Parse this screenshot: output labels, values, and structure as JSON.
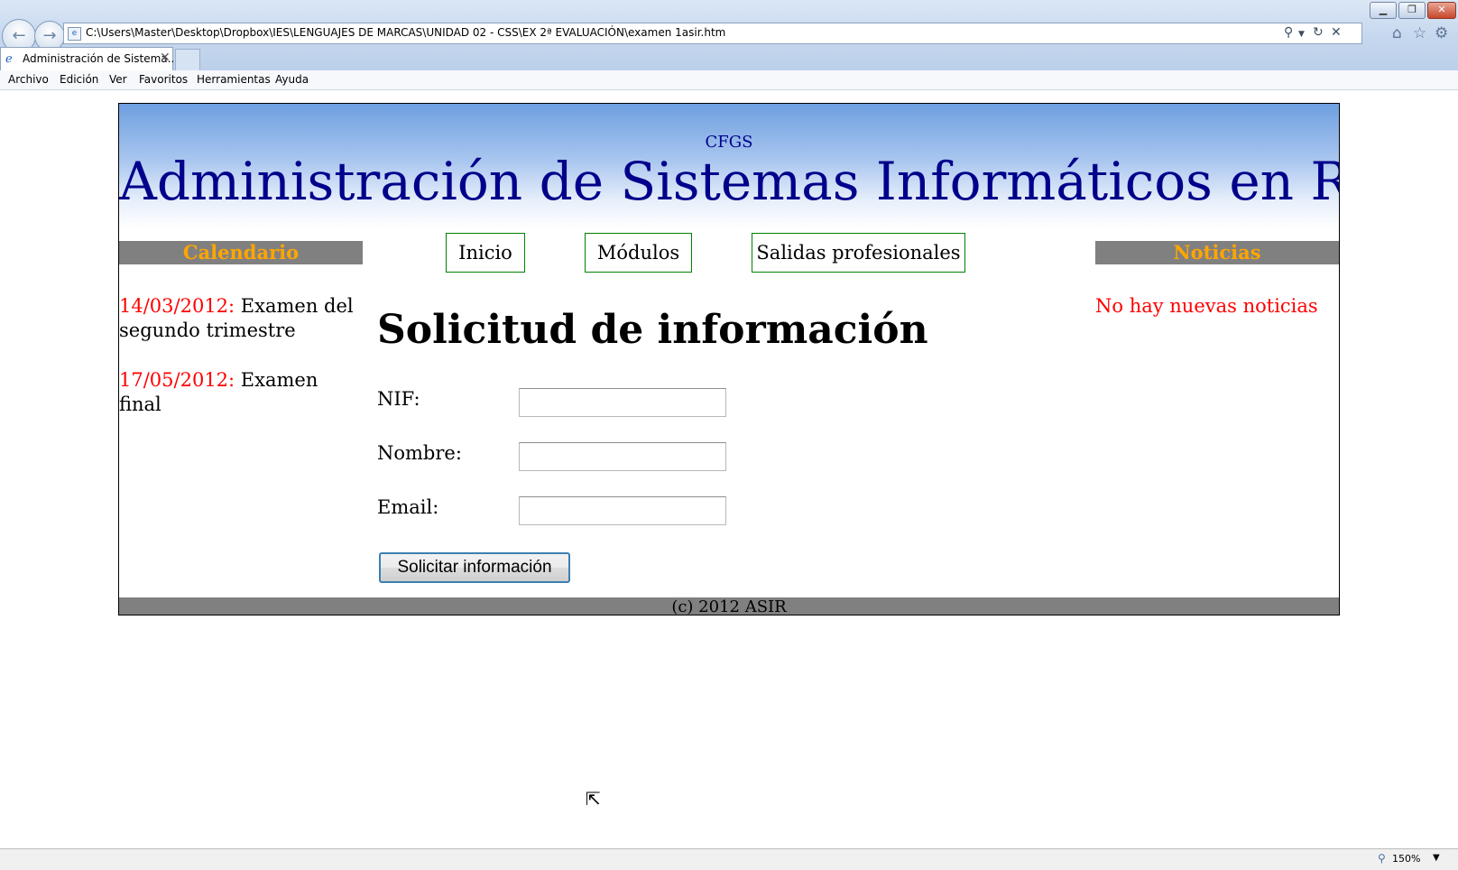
{
  "browser": {
    "address": "C:\\Users\\Master\\Desktop\\Dropbox\\IES\\LENGUAJES DE MARCAS\\UNIDAD 02 - CSS\\EX 2ª EVALUACIÓN\\examen 1asir.htm",
    "tab_title": "Administración de Sistema...",
    "menu": [
      "Archivo",
      "Edición",
      "Ver",
      "Favoritos",
      "Herramientas",
      "Ayuda"
    ],
    "zoom": "150%",
    "icons": {
      "back": "back-arrow-icon",
      "forward": "forward-arrow-icon",
      "search": "search-icon",
      "refresh": "refresh-icon",
      "stop": "stop-icon",
      "home": "home-icon",
      "favorites": "star-icon",
      "tools": "gear-icon"
    }
  },
  "page": {
    "header": {
      "subtitle": "CFGS",
      "title": "Administración de Sistemas Informáticos en Red"
    },
    "nav": [
      "Inicio",
      "Módulos",
      "Salidas profesionales"
    ],
    "calendar": {
      "heading": "Calendario",
      "items": [
        {
          "date": "14/03/2012:",
          "text": " Examen del segundo trimestre"
        },
        {
          "date": "17/05/2012:",
          "text": " Examen final"
        }
      ]
    },
    "news": {
      "heading": "Noticias",
      "text": "No hay nuevas noticias"
    },
    "form": {
      "title": "Solicitud de información",
      "fields": [
        {
          "label": "NIF:",
          "value": ""
        },
        {
          "label": "Nombre:",
          "value": ""
        },
        {
          "label": "Email:",
          "value": ""
        }
      ],
      "submit_label": "Solicitar información"
    },
    "footer": "(c) 2012 ASIR"
  },
  "colors": {
    "header_title": "#00008b",
    "side_heading_bg": "#808080",
    "side_heading_text": "#ffa500",
    "date_text": "#ff0000",
    "nav_border": "#008000"
  }
}
